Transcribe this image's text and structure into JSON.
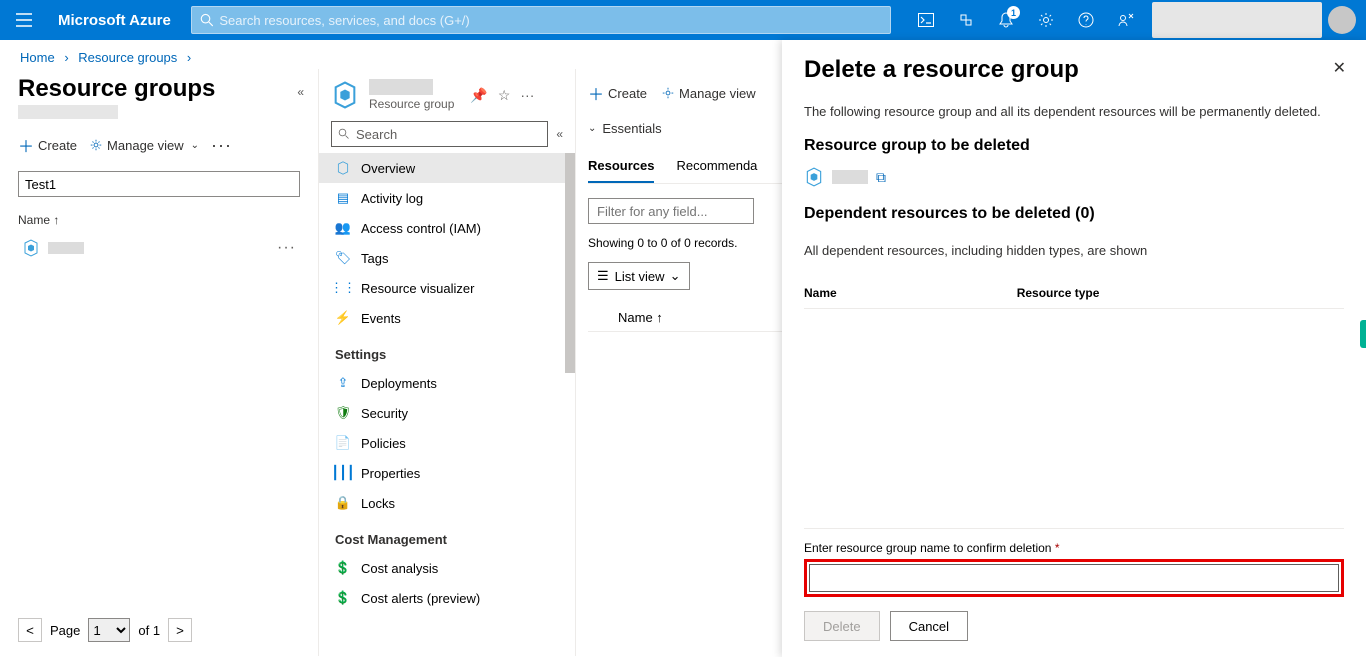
{
  "header": {
    "brand": "Microsoft Azure",
    "search_placeholder": "Search resources, services, and docs (G+/)",
    "notif_count": "1"
  },
  "breadcrumb": {
    "home": "Home",
    "rg": "Resource groups"
  },
  "panel1": {
    "title": "Resource groups",
    "create": "Create",
    "manage_view": "Manage view",
    "filter_value": "Test1",
    "col_name": "Name ↑",
    "page_label": "Page",
    "page_of": "of 1",
    "page_num": "1"
  },
  "panel2": {
    "subtitle": "Resource group",
    "search_placeholder": "Search",
    "items": {
      "overview": "Overview",
      "activity": "Activity log",
      "iam": "Access control (IAM)",
      "tags": "Tags",
      "visualizer": "Resource visualizer",
      "events": "Events"
    },
    "section_settings": "Settings",
    "settings": {
      "deployments": "Deployments",
      "security": "Security",
      "policies": "Policies",
      "properties": "Properties",
      "locks": "Locks"
    },
    "section_cost": "Cost Management",
    "cost": {
      "analysis": "Cost analysis",
      "alerts": "Cost alerts (preview)"
    }
  },
  "panel3": {
    "create": "Create",
    "manage_view": "Manage view",
    "essentials": "Essentials",
    "tab_resources": "Resources",
    "tab_reco": "Recommenda",
    "filter_placeholder": "Filter for any field...",
    "records": "Showing 0 to 0 of 0 records.",
    "view_label": "List view",
    "col_name": "Name ↑"
  },
  "flyout": {
    "title": "Delete a resource group",
    "desc": "The following resource group and all its dependent resources will be permanently deleted.",
    "sub1": "Resource group to be deleted",
    "sub2": "Dependent resources to be deleted (0)",
    "dep_text": "All dependent resources, including hidden types, are shown",
    "col_name": "Name",
    "col_type": "Resource type",
    "confirm_label": "Enter resource group name to confirm deletion",
    "btn_delete": "Delete",
    "btn_cancel": "Cancel"
  }
}
